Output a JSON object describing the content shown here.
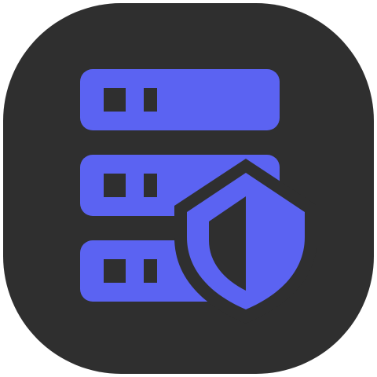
{
  "icon": {
    "name": "server-security-icon",
    "background_color": "#2f2f2f",
    "glyph_color": "#5b63f2",
    "cutout_color": "#2f2f2f",
    "server_units": 3,
    "shield": "shield-icon"
  }
}
